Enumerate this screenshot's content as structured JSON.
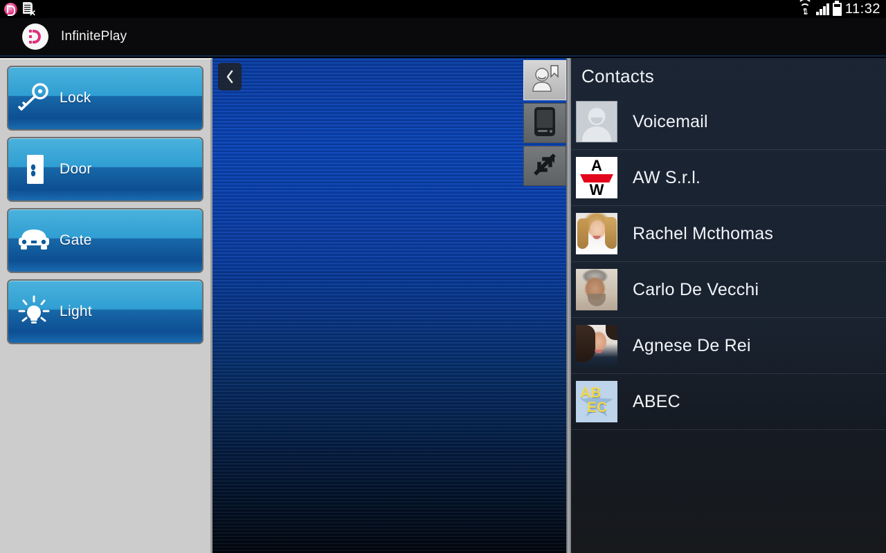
{
  "statusbar": {
    "time": "11:32",
    "notification_icons": [
      "infiniteplay-badge-icon",
      "sim-card-error-icon"
    ],
    "system_icons": [
      "wifi-icon",
      "cellular-signal-icon",
      "battery-icon"
    ],
    "signal_bars": 4,
    "battery_level_pct": 72
  },
  "titlebar": {
    "app_name": "InfinitePlay",
    "logo": "infiniteplay-logo-icon"
  },
  "left_panel": {
    "commands": [
      {
        "label": "Lock",
        "icon": "key-icon"
      },
      {
        "label": "Door",
        "icon": "door-icon"
      },
      {
        "label": "Gate",
        "icon": "car-icon"
      },
      {
        "label": "Light",
        "icon": "lightbulb-icon"
      }
    ]
  },
  "center_panel": {
    "collapse_label": "‹",
    "collapse_icon": "chevron-left-icon",
    "tabs": [
      {
        "name": "contacts",
        "icon": "contacts-bookmark-icon",
        "active": true
      },
      {
        "name": "device",
        "icon": "mobile-device-icon",
        "active": false
      },
      {
        "name": "calls",
        "icon": "call-transfer-icon",
        "active": false
      }
    ]
  },
  "contacts_panel": {
    "header": "Contacts",
    "items": [
      {
        "name": "Voicemail",
        "avatar": "default-person-avatar"
      },
      {
        "name": "AW S.r.l.",
        "avatar": "aw-logo-avatar",
        "logo_top": "A",
        "logo_bottom": "W"
      },
      {
        "name": "Rachel Mcthomas",
        "avatar": "photo-avatar"
      },
      {
        "name": "Carlo De Vecchi",
        "avatar": "photo-avatar"
      },
      {
        "name": "Agnese De Rei",
        "avatar": "photo-avatar"
      },
      {
        "name": "ABEC",
        "avatar": "abec-logo-avatar",
        "logo_top": "AB",
        "logo_bottom": "EC"
      }
    ]
  },
  "colors": {
    "button_blue_light": "#4bb2dd",
    "button_blue_dark": "#0d4f92",
    "panel_gray": "#cccccc",
    "center_blue": "#0b46bb",
    "contacts_bg": "#18212e",
    "brand_pink": "#e0307e"
  }
}
